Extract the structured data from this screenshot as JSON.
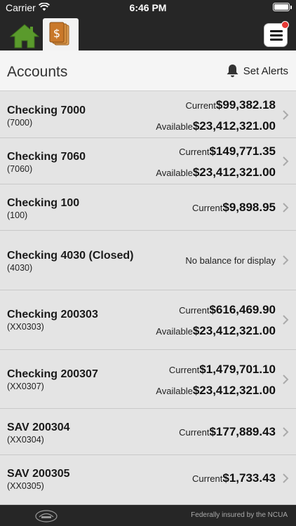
{
  "status_bar": {
    "carrier": "Carrier",
    "time": "6:46 PM"
  },
  "header": {
    "title": "Accounts",
    "alerts_label": "Set Alerts"
  },
  "accounts": [
    {
      "name": "Checking 7000",
      "number": "(7000)",
      "current_label": "Current",
      "current": "$99,382.18",
      "available_label": "Available",
      "available": "$23,412,321.00"
    },
    {
      "name": "Checking 7060",
      "number": "(7060)",
      "current_label": "Current",
      "current": "$149,771.35",
      "available_label": "Available",
      "available": "$23,412,321.00"
    },
    {
      "name": "Checking 100",
      "number": "(100)",
      "current_label": "Current",
      "current": "$9,898.95"
    },
    {
      "name": "Checking 4030 (Closed)",
      "number": "(4030)",
      "message": "No balance for display"
    },
    {
      "name": "Checking 200303",
      "number": "(XX0303)",
      "current_label": "Current",
      "current": "$616,469.90",
      "available_label": "Available",
      "available": "$23,412,321.00"
    },
    {
      "name": "Checking 200307",
      "number": "(XX0307)",
      "current_label": "Current",
      "current": "$1,479,701.10",
      "available_label": "Available",
      "available": "$23,412,321.00"
    },
    {
      "name": "SAV 200304",
      "number": "(XX0304)",
      "current_label": "Current",
      "current": "$177,889.43"
    },
    {
      "name": "SAV 200305",
      "number": "(XX0305)",
      "current_label": "Current",
      "current": "$1,733.43"
    }
  ],
  "footer": {
    "insured_text": "Federally insured by the NCUA"
  },
  "colors": {
    "top_bar": "#262626",
    "home_green": "#5a9a2c",
    "accounts_orange": "#c9782a",
    "alert_red": "#e53935"
  },
  "icons": [
    "wifi-icon",
    "battery-icon",
    "home-icon",
    "accounts-dollar-icon",
    "hamburger-menu-icon",
    "bell-icon",
    "chevron-right-icon",
    "credit-union-logo-icon"
  ]
}
